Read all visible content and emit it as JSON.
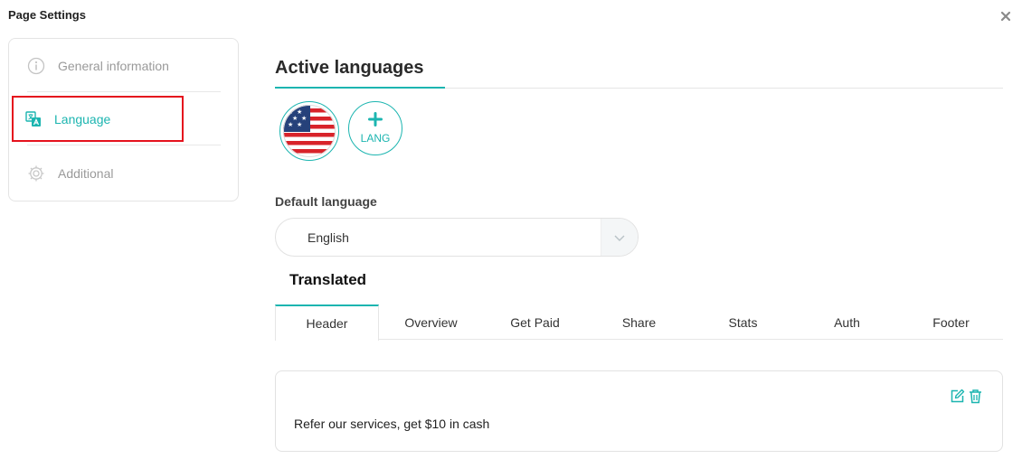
{
  "dialog": {
    "title": "Page Settings"
  },
  "sidebar": {
    "items": [
      {
        "label": "General information",
        "icon": "info-icon",
        "active": false
      },
      {
        "label": "Language",
        "icon": "translate-icon",
        "active": true
      },
      {
        "label": "Additional",
        "icon": "gear-icon",
        "active": false
      }
    ]
  },
  "main": {
    "section_title": "Active languages",
    "add_language_label": "LANG",
    "default_language_label": "Default language",
    "default_language_value": "English",
    "translated_title": "Translated",
    "tabs": [
      "Header",
      "Overview",
      "Get Paid",
      "Share",
      "Stats",
      "Auth",
      "Footer"
    ],
    "active_tab": "Header",
    "content_text": "Refer our services, get $10 in cash"
  },
  "colors": {
    "accent": "#1cb5b0",
    "highlight": "#e5121d"
  }
}
